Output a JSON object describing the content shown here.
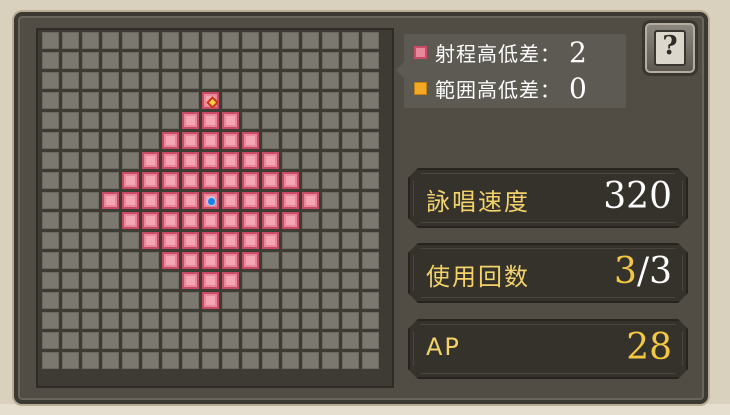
{
  "legend": {
    "range_height_label": "射程高低差：",
    "range_height_value": "2",
    "area_height_label": "範囲高低差：",
    "area_height_value": "0",
    "range_color": "#e8889b",
    "area_color": "#f4a926"
  },
  "help_button": {
    "icon": "question-book-icon",
    "glyph": "?"
  },
  "stats": {
    "cast_speed": {
      "label": "詠唱速度",
      "value": "320"
    },
    "uses": {
      "label": "使用回数",
      "current": "3",
      "slash": "/",
      "max": "3"
    },
    "ap": {
      "label": "AP",
      "value": "28"
    }
  },
  "grid": {
    "cols": 17,
    "rows": 17,
    "caster": {
      "col": 8,
      "row": 8
    },
    "target": {
      "col": 8,
      "row": 3
    },
    "range_rows": [
      [
        3,
        8,
        8
      ],
      [
        4,
        7,
        9
      ],
      [
        5,
        6,
        10
      ],
      [
        6,
        5,
        11
      ],
      [
        7,
        4,
        12
      ],
      [
        8,
        3,
        13
      ],
      [
        9,
        4,
        12
      ],
      [
        10,
        5,
        11
      ],
      [
        11,
        6,
        10
      ],
      [
        12,
        7,
        9
      ],
      [
        13,
        8,
        8
      ]
    ]
  }
}
